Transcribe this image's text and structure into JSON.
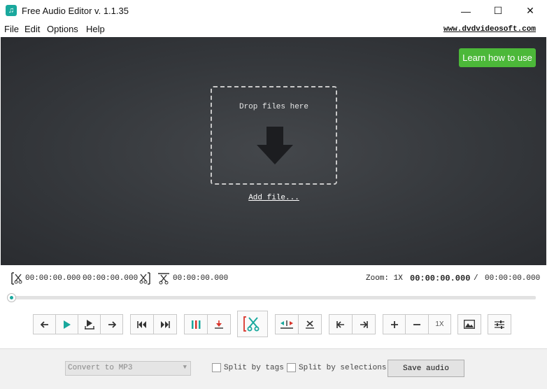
{
  "window": {
    "title": "Free Audio Editor v. 1.1.35",
    "app_icon_glyph": "♫",
    "minimize_glyph": "—",
    "maximize_glyph": "☐",
    "close_glyph": "✕"
  },
  "menu": {
    "items": [
      "File",
      "Edit",
      "Options",
      "Help"
    ],
    "site_link": "www.dvdvideosoft.com"
  },
  "drop_area": {
    "learn_button": "Learn how to use",
    "drop_text": "Drop files here",
    "add_file": "Add file..."
  },
  "timing": {
    "selection_start": "00:00:00.000",
    "selection_end": "00:00:00.000",
    "selection_length": "00:00:00.000",
    "zoom_label": "Zoom: 1X",
    "current_time": "00:00:00.000",
    "separator": "/",
    "total_time": "00:00:00.000"
  },
  "seek": {
    "position": 0
  },
  "toolbar": {
    "zoom_button_label": "1X"
  },
  "bottom": {
    "format_select": "Convert to MP3",
    "split_by_tags": "Split by tags",
    "split_by_selections": "Split by selections",
    "save_button": "Save audio"
  },
  "colors": {
    "accent": "#19a89d",
    "learn_button": "#4cb839",
    "cut_icon": "#19a89d",
    "bracket_red": "#d9342b"
  }
}
